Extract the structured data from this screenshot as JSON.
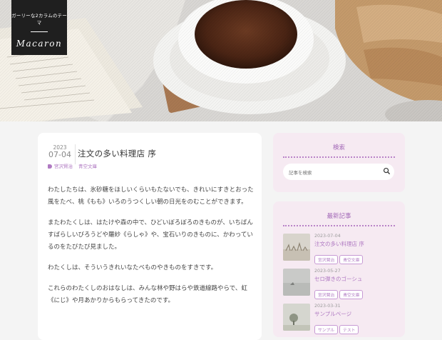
{
  "site": {
    "tagline": "ガーリーな2カラムのテーマ",
    "name": "Macaron"
  },
  "post": {
    "date_year": "2023",
    "date_md": "07-04",
    "title": "注文の多い料理店 序",
    "tags": [
      "宮沢賢治",
      "青空文庫"
    ],
    "paragraphs": [
      "わたしたちは、氷砂糖をほしいくらいもたないでも、きれいにすきとおった風をたべ、桃《もも》いろのうつくしい朝の日光をのむことができます。",
      "またわたくしは、はたけや森の中で、ひどいぼろぼろのきものが、いちばんすばらしいびろうどや羅紗《らしゃ》や、宝石いりのきものに、かわっているのをたびたび見ました。",
      "わたくしは、そういうきれいなたべものやきものをすきです。",
      "これらのわたくしのおはなしは、みんな林や野はらや鉄道線路やらで、虹《にじ》や月あかりからもらってきたのです。"
    ]
  },
  "search_widget": {
    "title": "検索",
    "placeholder": "記事を検索"
  },
  "recent_widget": {
    "title": "最新記事",
    "items": [
      {
        "date": "2023-07-04",
        "title": "注文の多い料理店 序",
        "tags": [
          "宮沢賢治",
          "青空文庫"
        ]
      },
      {
        "date": "2023-05-27",
        "title": "セロ弾きのゴーシュ",
        "tags": [
          "宮沢賢治",
          "青空文庫"
        ]
      },
      {
        "date": "2023-03-31",
        "title": "サンプルページ",
        "tags": [
          "サンプル",
          "テスト"
        ]
      }
    ]
  },
  "colors": {
    "accent": "#b07ac2",
    "sidebar_bg": "#f6eaf2",
    "logo_bg": "#1f1f1f"
  },
  "icons": [
    "tag-icon",
    "search-icon"
  ]
}
